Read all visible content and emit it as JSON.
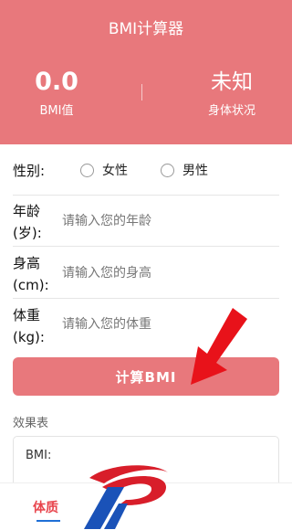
{
  "header": {
    "title": "BMI计算器",
    "bmi_value": "0.0",
    "bmi_label": "BMI值",
    "status_value": "未知",
    "status_label": "身体状况"
  },
  "form": {
    "gender_label": "性别:",
    "female": "女性",
    "male": "男性",
    "age_label_line1": "年龄",
    "age_label_line2": "(岁):",
    "age_placeholder": "请输入您的年龄",
    "height_label_line1": "身高",
    "height_label_line2": "(cm):",
    "height_placeholder": "请输入您的身高",
    "weight_label_line1": "体重",
    "weight_label_line2": "(kg):",
    "weight_placeholder": "请输入您的体重",
    "calc_button": "计算BMI"
  },
  "result": {
    "section_title": "效果表",
    "bmi_text": "BMI:"
  },
  "tabbar": {
    "active_tab": "体质"
  },
  "colors": {
    "primary": "#e8787c",
    "arrow": "#e8121a",
    "tab_active": "#e8444c"
  }
}
